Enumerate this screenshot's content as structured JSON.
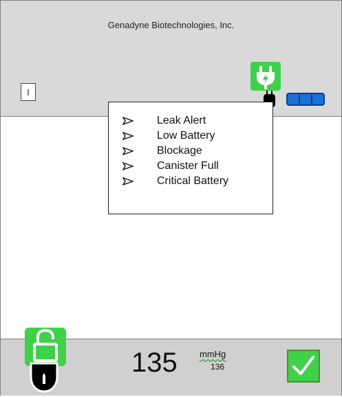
{
  "header": {
    "company": "Genadyne Biotechnologies, Inc.",
    "indicator": "I"
  },
  "alerts": [
    "Leak Alert",
    "Low Battery",
    "Blockage",
    "Canister Full",
    "Critical Battery"
  ],
  "footer": {
    "pressure": "135",
    "unit": "mmHg",
    "set_pressure": "136"
  },
  "icons": {
    "plug": "power-plug-icon",
    "cord": "power-cord-icon",
    "battery": "battery-icon",
    "lock": "unlocked-padlock-icon",
    "mouse": "mouse-icon",
    "confirm": "checkmark-icon",
    "bullet": "arrow-bullet-icon"
  },
  "colors": {
    "header_bg": "#d9d9d9",
    "footer_bg": "#d0d0d0",
    "accent_green": "#3fd14a",
    "battery_blue": "#1a6fd8"
  }
}
